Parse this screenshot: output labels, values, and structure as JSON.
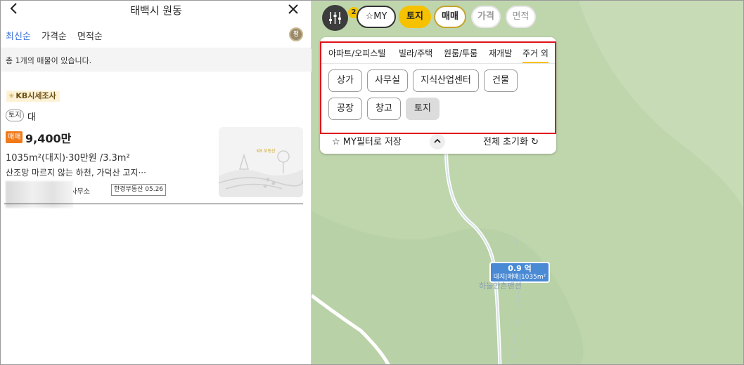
{
  "header": {
    "title": "태백시 원동",
    "back_icon": "chevron-left-icon",
    "close_icon": "close-icon"
  },
  "sort": {
    "options": [
      "최신순",
      "가격순",
      "면적순"
    ],
    "active": "최신순",
    "icon_label": "평"
  },
  "summary": {
    "count_text": "총 1개의 매물이 있습니다."
  },
  "listing": {
    "kb_badge": "KB시세조사",
    "property_tag": "토지",
    "use_type": "대",
    "deal_tag": "매매",
    "price": "9,400만",
    "area": "1035m²(대지)·30만원 /3.3m²",
    "description": "산조망 마르지 않는 하천, 가덕산 고지···",
    "agent_suffix": "중개사무소",
    "source": "한경부동산 05.26",
    "thumb_text": "KB 부동산"
  },
  "map": {
    "filter_badge": "2",
    "chips": {
      "my": "MY",
      "land": "토지",
      "sale": "매매",
      "price": "가격",
      "size": "면적"
    },
    "category_tabs": [
      "아파트/오피스텔",
      "빌라/주택",
      "원룸/투룸",
      "재개발",
      "주거 외"
    ],
    "active_tab": "주거 외",
    "sub_types": [
      "상가",
      "사무실",
      "지식산업센터",
      "건물",
      "공장",
      "창고",
      "토지"
    ],
    "selected_sub_type": "토지",
    "save_my_filter": "MY필터로 저장",
    "reset_all": "전체 초기화",
    "marker": {
      "price": "0.9 억",
      "detail": "대지|매매|1035m²"
    },
    "place_label": "하늘안촌팬션"
  },
  "colors": {
    "accent_yellow": "#f6c200",
    "sale_orange": "#f07a1a",
    "marker_blue": "#4a8ad4",
    "highlight_red": "#e0101a",
    "map_green": "#bfd6ad"
  }
}
